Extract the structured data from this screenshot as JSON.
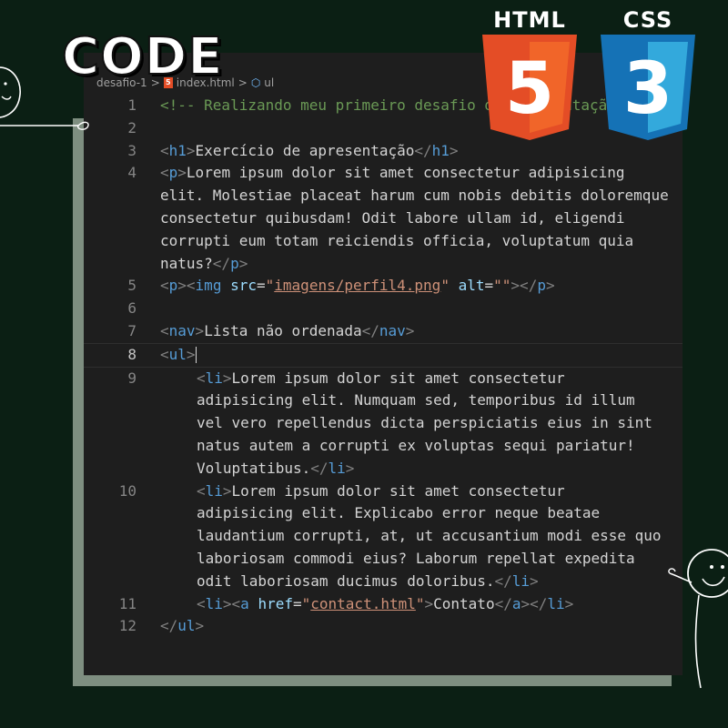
{
  "title": "CODE",
  "badges": {
    "html": {
      "label": "HTML",
      "number": "5",
      "color_dark": "#e44d26",
      "color_light": "#f16529"
    },
    "css": {
      "label": "CSS",
      "number": "3",
      "color_dark": "#1572b6",
      "color_light": "#33a9dc"
    }
  },
  "breadcrumb": {
    "folder": "desafio-1",
    "file": "index.html",
    "symbol": "ul",
    "separator": ">"
  },
  "editor": {
    "active_line": "8",
    "lines": [
      {
        "num": "1",
        "comment": "<!-- Realizando meu primeiro desafio de apresentação -->"
      },
      {
        "num": "2"
      },
      {
        "num": "3",
        "open_tag": "h1",
        "text": "Exercício de apresentação",
        "close_tag": "h1"
      },
      {
        "num": "4",
        "open_tag": "p",
        "text": "Lorem ipsum dolor sit amet consectetur adipisicing elit. Molestiae placeat harum cum nobis debitis doloremque consectetur quibusdam! Odit labore ullam id, eligendi corrupti eum totam reiciendis officia, voluptatum quia natus?",
        "close_tag": "p"
      },
      {
        "num": "5",
        "open_tag": "p",
        "inner_tag": "img",
        "src_attr": "src",
        "src_val": "imagens/perfil4.png",
        "alt_attr": "alt",
        "alt_val": "",
        "close_tag": "p"
      },
      {
        "num": "6"
      },
      {
        "num": "7",
        "open_tag": "nav",
        "text": "Lista não ordenada",
        "close_tag": "nav"
      },
      {
        "num": "8",
        "open_tag": "ul"
      },
      {
        "num": "9",
        "open_tag": "li",
        "text": "Lorem ipsum dolor sit amet consectetur adipisicing elit. Numquam sed, temporibus id illum vel vero repellendus dicta perspiciatis eius in sint natus autem a corrupti ex voluptas sequi pariatur! Voluptatibus.",
        "close_tag": "li"
      },
      {
        "num": "10",
        "open_tag": "li",
        "text": "Lorem ipsum dolor sit amet consectetur adipisicing elit. Explicabo error neque beatae laudantium corrupti, at, ut accusantium modi esse quo laboriosam commodi eius? Laborum repellat expedita odit laboriosam ducimus doloribus.",
        "close_tag": "li"
      },
      {
        "num": "11",
        "open_tag": "li",
        "inner_tag": "a",
        "href_attr": "href",
        "href_val": "contact.html",
        "text": "Contato",
        "inner_close": "a",
        "close_tag": "li"
      },
      {
        "num": "12",
        "close_tag": "ul"
      }
    ]
  }
}
